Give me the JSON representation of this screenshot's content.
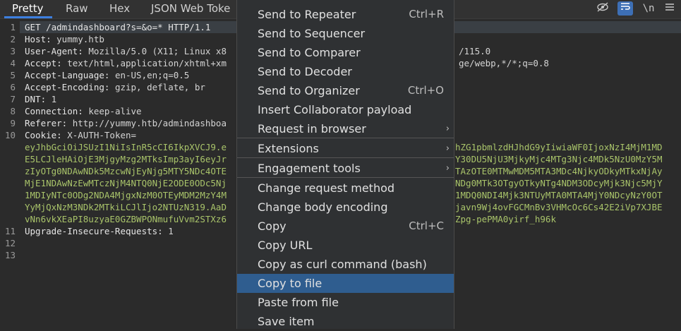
{
  "tabs": [
    {
      "label": "Pretty"
    },
    {
      "label": "Raw"
    },
    {
      "label": "Hex"
    },
    {
      "label": "JSON Web Toke"
    }
  ],
  "toolbar": {
    "newline_label": "\\n"
  },
  "editor": {
    "line_numbers": [
      "1",
      "2",
      "3",
      "4",
      "5",
      "6",
      "7",
      "8",
      "9",
      "10",
      "",
      "",
      "",
      "",
      "",
      "",
      "",
      "11",
      "12",
      "13"
    ],
    "lines": [
      {
        "key": "GET /admindashboard?s=&o=* HTTP/1.1"
      },
      {
        "key": "Host: ",
        "val": "yummy.htb"
      },
      {
        "key": "User-Agent: ",
        "val": "Mozilla/5.0 (X11; Linux x8",
        "tail": "/115.0"
      },
      {
        "key": "Accept: ",
        "val": "text/html,application/xhtml+xm",
        "tail": "ge/webp,*/*;q=0.8"
      },
      {
        "key": "Accept-Language: ",
        "val": "en-US,en;q=0.5"
      },
      {
        "key": "Accept-Encoding: ",
        "val": "gzip, deflate, br"
      },
      {
        "key": "DNT: ",
        "val": "1"
      },
      {
        "key": "Connection: ",
        "val": "keep-alive"
      },
      {
        "key": "Referer: ",
        "val": "http://yummy.htb/admindashboa"
      },
      {
        "key": "Cookie: ",
        "val": "X-AUTH-Token="
      },
      {
        "cookie": "eyJhbGciOiJSUzI1NiIsInR5cCI6IkpXVCJ9.e",
        "tail": "hZG1pbmlzdHJhdG9yIiwiaWF0IjoxNzI4MjM1MD"
      },
      {
        "cookie": "E5LCJleHAiOjE3MjgyMzg2MTksImp3ayI6eyJr",
        "tail": "Y30DU5NjU3MjkyMjc4MTg3Njc4MDk5NzU0MzY5M"
      },
      {
        "cookie": "zIyOTg0NDAwNDk5MzcwNjEyNjg5MTY5NDc4OTE",
        "tail": "TAzOTE0MTMwMDM5MTA3MDc4NjkyODkyMTkxNjAy"
      },
      {
        "cookie": "MjE1NDAwNzEwMTczNjM4NTQ0NjE2ODE0ODc5Nj",
        "tail": "NDg0MTk3OTgyOTkyNTg4NDM3ODcyMjk3Njc5MjY"
      },
      {
        "cookie": "1MDIyNTc0ODg2NDA4MjgxNzM0OTEyMDM2MzY4M",
        "tail": "1MDQ0NDI4Mjk3NTUyMTA0MTA4MjY0NDcyNzY0OT"
      },
      {
        "cookie": "YyMjQxNzM3NDk2MTkiLCJlIjo2NTUzN319.AaD",
        "tail": "javn9Wj4ovFGCMnBv3VHMcOc6Cs42E2iVp7XJBE"
      },
      {
        "cookie": "vNn6vkXEaPI8uzyaE0GZBWPONmufuVvm2STXz6",
        "tail": "Zpg-pePMA0yirf_h96k"
      },
      {
        "key": "Upgrade-Insecure-Requests: ",
        "val": "1"
      },
      {
        "key": ""
      },
      {
        "key": ""
      }
    ]
  },
  "context_menu": {
    "items": [
      {
        "label": "Send to Repeater",
        "shortcut": "Ctrl+R"
      },
      {
        "label": "Send to Sequencer",
        "shortcut": ""
      },
      {
        "label": "Send to Comparer",
        "shortcut": ""
      },
      {
        "label": "Send to Decoder",
        "shortcut": ""
      },
      {
        "label": "Send to Organizer",
        "shortcut": "Ctrl+O"
      },
      {
        "label": "Insert Collaborator payload",
        "shortcut": ""
      },
      {
        "label": "Request in browser",
        "shortcut": ""
      },
      {
        "label": "Extensions",
        "shortcut": ""
      },
      {
        "label": "Engagement tools",
        "shortcut": ""
      },
      {
        "label": "Change request method",
        "shortcut": ""
      },
      {
        "label": "Change body encoding",
        "shortcut": ""
      },
      {
        "label": "Copy",
        "shortcut": "Ctrl+C"
      },
      {
        "label": "Copy URL",
        "shortcut": ""
      },
      {
        "label": "Copy as curl command (bash)",
        "shortcut": ""
      },
      {
        "label": "Copy to file",
        "shortcut": ""
      },
      {
        "label": "Paste from file",
        "shortcut": ""
      },
      {
        "label": "Save item",
        "shortcut": ""
      }
    ],
    "submenu_arrow": "›"
  },
  "colors": {
    "accent": "#3d7fe0",
    "highlight": "#2f5d8f",
    "cookie": "#a9c46a"
  }
}
